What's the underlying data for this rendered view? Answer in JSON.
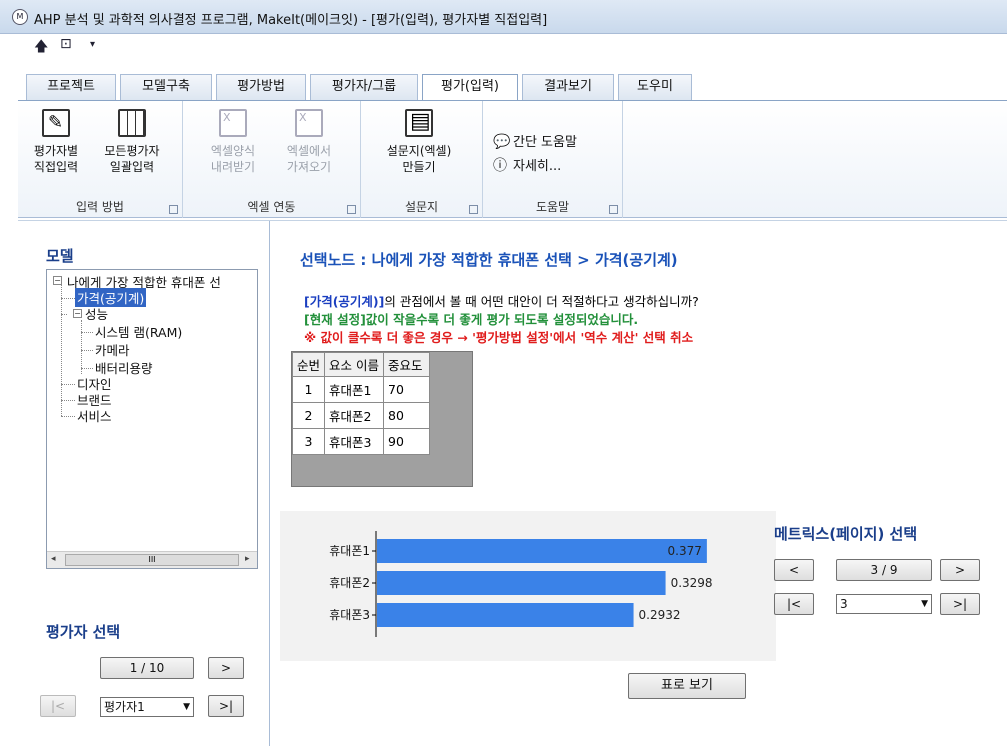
{
  "window": {
    "title": "AHP 분석 및 과학적 의사결정 프로그램, MakeIt(메이크잇) - [평가(입력), 평가자별 직접입력]",
    "icon_text": "M"
  },
  "ribbon": {
    "tabs": [
      "프로젝트",
      "모델구축",
      "평가방법",
      "평가자/그룹",
      "평가(입력)",
      "결과보기",
      "도우미"
    ],
    "active_tab": 4,
    "groups": [
      {
        "label": "입력 방법",
        "buttons": [
          {
            "label": "평가자별\n직접입력",
            "icon": "edit-icon",
            "enabled": true
          },
          {
            "label": "모든평가자\n일괄입력",
            "icon": "grid-icon",
            "enabled": true
          }
        ]
      },
      {
        "label": "엑셀 연동",
        "buttons": [
          {
            "label": "엑셀양식\n내려받기",
            "icon": "excel-download-icon",
            "enabled": false
          },
          {
            "label": "엑셀에서\n가져오기",
            "icon": "excel-import-icon",
            "enabled": false
          }
        ]
      },
      {
        "label": "설문지",
        "buttons": [
          {
            "label": "설문지(엑셀)\n만들기",
            "icon": "survey-icon",
            "enabled": true
          }
        ]
      },
      {
        "label": "도움말",
        "items": [
          {
            "label": "간단 도움말",
            "icon": "speech-bubble-icon"
          },
          {
            "label": "자세히...",
            "icon": "info-icon"
          }
        ]
      }
    ]
  },
  "left": {
    "model_title": "모델",
    "tree": {
      "root": "나에게 가장 적합한 휴대폰 선",
      "items": [
        {
          "label": "가격(공기계)",
          "selected": true
        },
        {
          "label": "성능",
          "children": [
            "시스템 램(RAM)",
            "카메라",
            "배터리용량"
          ]
        },
        {
          "label": "디자인"
        },
        {
          "label": "브랜드"
        },
        {
          "label": "서비스"
        }
      ]
    },
    "scroll_thumb": "III",
    "evaluator_title": "평가자 선택",
    "evaluator_page": "1 / 10",
    "evaluator_next": ">",
    "evaluator_first": "|<",
    "evaluator_last": ">|",
    "evaluator_selected": "평가자1"
  },
  "main": {
    "node_title": "선택노드 : 나에게 가장 적합한 휴대폰 선택 > 가격(공기계)",
    "q1_bold": "[가격(공기계)]",
    "q1_rest": "의 관점에서 볼 때 어떤 대안이 더 적절하다고 생각하십니까?",
    "q2": "[현재 설정]값이 작을수록 더 좋게 평가 되도록 설정되었습니다.",
    "q3": "※ 값이 클수록 더 좋은 경우 → '평가방법 설정'에서 '역수 계산' 선택 취소",
    "table": {
      "headers": [
        "순번",
        "요소 이름",
        "중요도"
      ],
      "rows": [
        [
          "1",
          "휴대폰1",
          "70"
        ],
        [
          "2",
          "휴대폰2",
          "80"
        ],
        [
          "3",
          "휴대폰3",
          "90"
        ]
      ]
    },
    "table_view_button": "표로 보기"
  },
  "chart_data": {
    "type": "bar",
    "orientation": "horizontal",
    "categories": [
      "휴대폰1",
      "휴대폰2",
      "휴대폰3"
    ],
    "values": [
      0.377,
      0.3298,
      0.2932
    ],
    "value_labels": [
      "0.377",
      "0.3298",
      "0.2932"
    ],
    "xlim": [
      0,
      0.4
    ],
    "bar_color": "#3a82e8",
    "grid": false
  },
  "matrix": {
    "title": "메트릭스(페이지) 선택",
    "prev": "<",
    "next": ">",
    "page": "3 / 9",
    "first": "|<",
    "last": ">|",
    "selected": "3"
  }
}
